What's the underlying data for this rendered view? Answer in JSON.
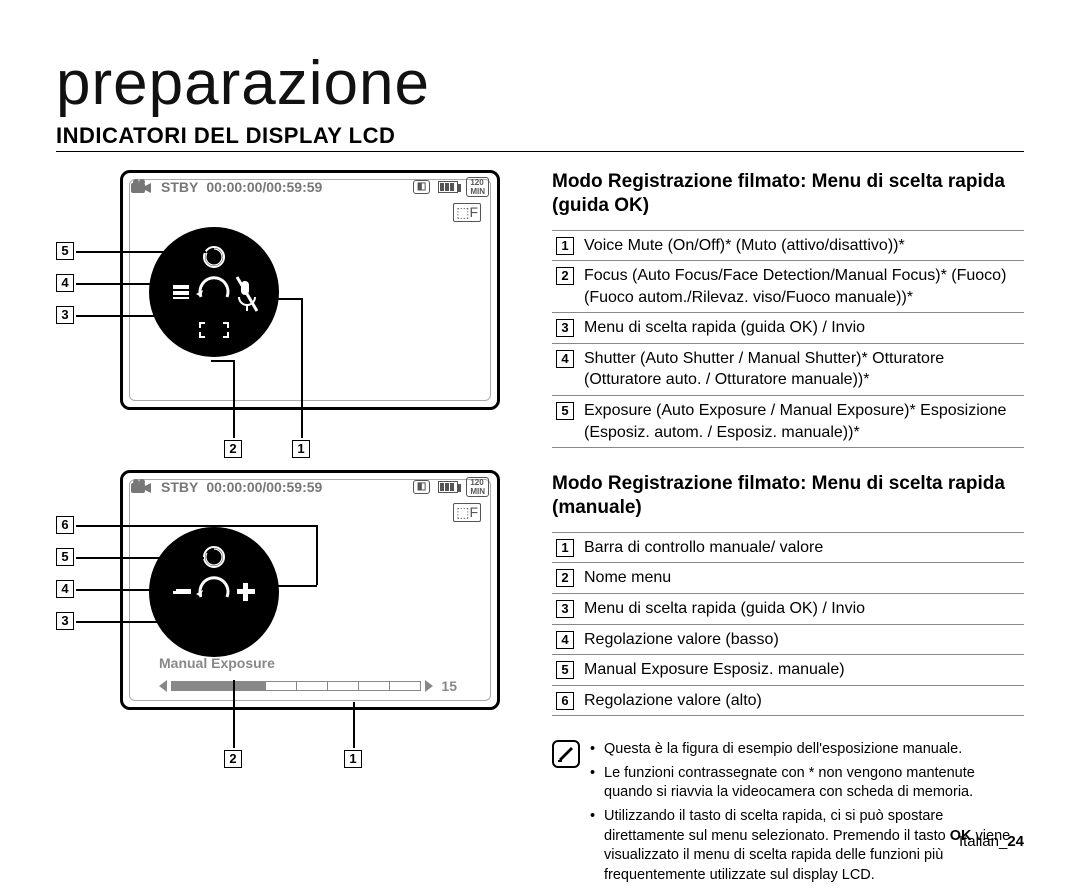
{
  "page_title": "preparazione",
  "section_title": "INDICATORI DEL DISPLAY LCD",
  "lcd_status": {
    "mode": "STBY",
    "timecode": "00:00:00/00:59:59",
    "rec_min": "120 MIN"
  },
  "manual_exposure": {
    "label": "Manual Exposure",
    "value": "15"
  },
  "quick_guide": {
    "heading": "Modo Registrazione filmato: Menu di scelta rapida (guida OK)",
    "items": [
      "Voice Mute (On/Off)* (Muto (attivo/disattivo))*",
      "Focus (Auto Focus/Face Detection/Manual Focus)* (Fuoco) (Fuoco autom./Rilevaz. viso/Fuoco manuale))*",
      "Menu di scelta rapida (guida OK) / Invio",
      "Shutter (Auto Shutter / Manual Shutter)* Otturatore (Otturatore auto. / Otturatore manuale))*",
      "Exposure (Auto Exposure / Manual Exposure)* Esposizione (Esposiz. autom. / Esposiz. manuale))*"
    ]
  },
  "manual_guide": {
    "heading": "Modo Registrazione filmato: Menu di scelta rapida (manuale)",
    "items": [
      "Barra di controllo manuale/ valore",
      "Nome menu",
      "Menu di scelta rapida (guida OK) / Invio",
      "Regolazione valore (basso)",
      "Manual Exposure Esposiz. manuale)",
      "Regolazione valore (alto)"
    ]
  },
  "notes": {
    "items": [
      "Questa è la figura di esempio dell'esposizione manuale.",
      "Le funzioni contrassegnate con * non vengono mantenute quando si riavvia la videocamera con scheda di memoria.",
      "Utilizzando il tasto di scelta rapida, ci si può spostare direttamente sul menu selezionato. Premendo il tasto OK viene visualizzato il menu di scelta rapida delle funzioni più frequentemente utilizzate sul display LCD."
    ],
    "ok_word": "OK"
  },
  "footer": {
    "lang": "Italian",
    "page": "24"
  }
}
